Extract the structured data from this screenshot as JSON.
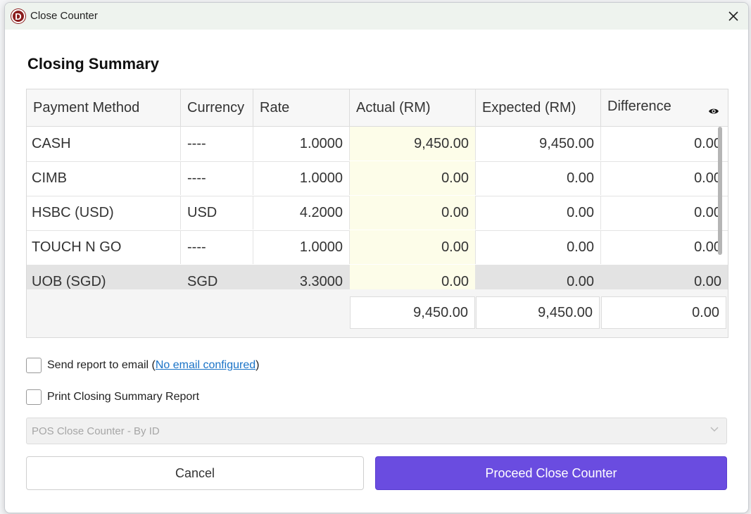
{
  "window": {
    "title": "Close Counter",
    "logo_letter": "D"
  },
  "heading": "Closing Summary",
  "table": {
    "headers": [
      "Payment Method",
      "Currency",
      "Rate",
      "Actual (RM)",
      "Expected (RM)",
      "Difference"
    ],
    "rows": [
      {
        "method": "CASH",
        "currency": "----",
        "rate": "1.0000",
        "actual": "9,450.00",
        "expected": "9,450.00",
        "difference": "0.00"
      },
      {
        "method": "CIMB",
        "currency": "----",
        "rate": "1.0000",
        "actual": "0.00",
        "expected": "0.00",
        "difference": "0.00"
      },
      {
        "method": "HSBC (USD)",
        "currency": "USD",
        "rate": "4.2000",
        "actual": "0.00",
        "expected": "0.00",
        "difference": "0.00"
      },
      {
        "method": "TOUCH N GO",
        "currency": "----",
        "rate": "1.0000",
        "actual": "0.00",
        "expected": "0.00",
        "difference": "0.00"
      },
      {
        "method": "UOB (SGD)",
        "currency": "SGD",
        "rate": "3.3000",
        "actual": "0.00",
        "expected": "0.00",
        "difference": "0.00"
      }
    ],
    "totals": {
      "actual": "9,450.00",
      "expected": "9,450.00",
      "difference": "0.00"
    }
  },
  "options": {
    "email_label": "Send report to email (",
    "email_link": "No email configured",
    "email_close": " )",
    "print_label": "Print Closing Summary Report",
    "report_select": "POS Close Counter - By ID"
  },
  "buttons": {
    "cancel": "Cancel",
    "proceed": "Proceed Close Counter"
  },
  "colors": {
    "accent": "#6a4ce0",
    "actual_column_bg": "#fdfde9",
    "link": "#1a73c7"
  }
}
